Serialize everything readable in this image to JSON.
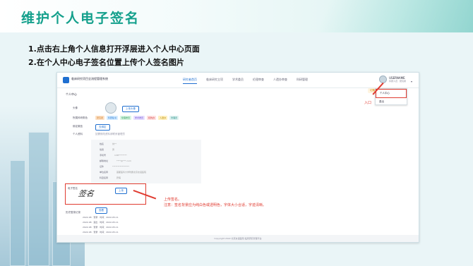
{
  "slide": {
    "title": "维护个人电子签名",
    "steps": [
      "1.点击右上角个人信息打开浮层进入个人中心页面",
      "2.在个人中心电子签名位置上传个人签名图片"
    ]
  },
  "app": {
    "title": "临床研究项目全流程管理系统",
    "nav": [
      "研究者首页",
      "临床研究立项",
      "学术委员",
      "伦理审查",
      "人遗办审查",
      "科研管理"
    ],
    "nav_active_index": 0,
    "user": {
      "name": "USERNAME",
      "sub": "科研人员 · 研究者"
    },
    "dropdown": [
      "个人中心",
      "退出"
    ],
    "tip_button": "切换角色"
  },
  "profile": {
    "panel_title": "个人中心",
    "avatar_label": "头像",
    "upload_avatar_button": "上传头像",
    "roles_label": "所属科研角色",
    "roles": [
      "研究者",
      "科研秘书",
      "伦理委员",
      "学术委员",
      "机构办",
      "人遗办",
      "管理员"
    ],
    "role_colors": [
      "#fde2c8",
      "#d6ecff",
      "#d9f5e3",
      "#e8e0ff",
      "#ffe0e0",
      "#fff1c2",
      "#e0f2f1"
    ],
    "bind_label": "绑定微信",
    "bind_button": "去绑定",
    "info_label": "个人资料",
    "info_hint": "如需修改资料请联系管理员",
    "info_fields": [
      {
        "k": "姓名",
        "v": "刘**"
      },
      {
        "k": "性别",
        "v": "男"
      },
      {
        "k": "手机号",
        "v": "138********"
      },
      {
        "k": "邮箱地址",
        "v": "****@***.com"
      },
      {
        "k": "证件",
        "v": "****************"
      },
      {
        "k": "单位名称",
        "v": "首都医科大学附属北京友谊医院"
      },
      {
        "k": "科室名称",
        "v": "肝病"
      }
    ],
    "signature_label": "电子签名",
    "signature_text": "签名",
    "upload_signature_button": "上传",
    "history_label": "历史登录记录",
    "history_button": "查看",
    "history": [
      "2022-08 · 登录 · 时间：2022-05-11",
      "2022-08 · 退出 · 时间：2022-05-11",
      "2022-08 · 登录 · 时间：2022-05-11",
      "2022-08 · 登录 · 时间：2022-05-11"
    ],
    "footer": "Copyright 2022 北京友谊医院 临床研究管理平台"
  },
  "annotations": {
    "entry": "入口",
    "upload_title": "上传签名。",
    "upload_note": "注意：签名背景应为纯白色或透明色，字体大小合适，字迹清晰。",
    "color": "#e03c31"
  }
}
